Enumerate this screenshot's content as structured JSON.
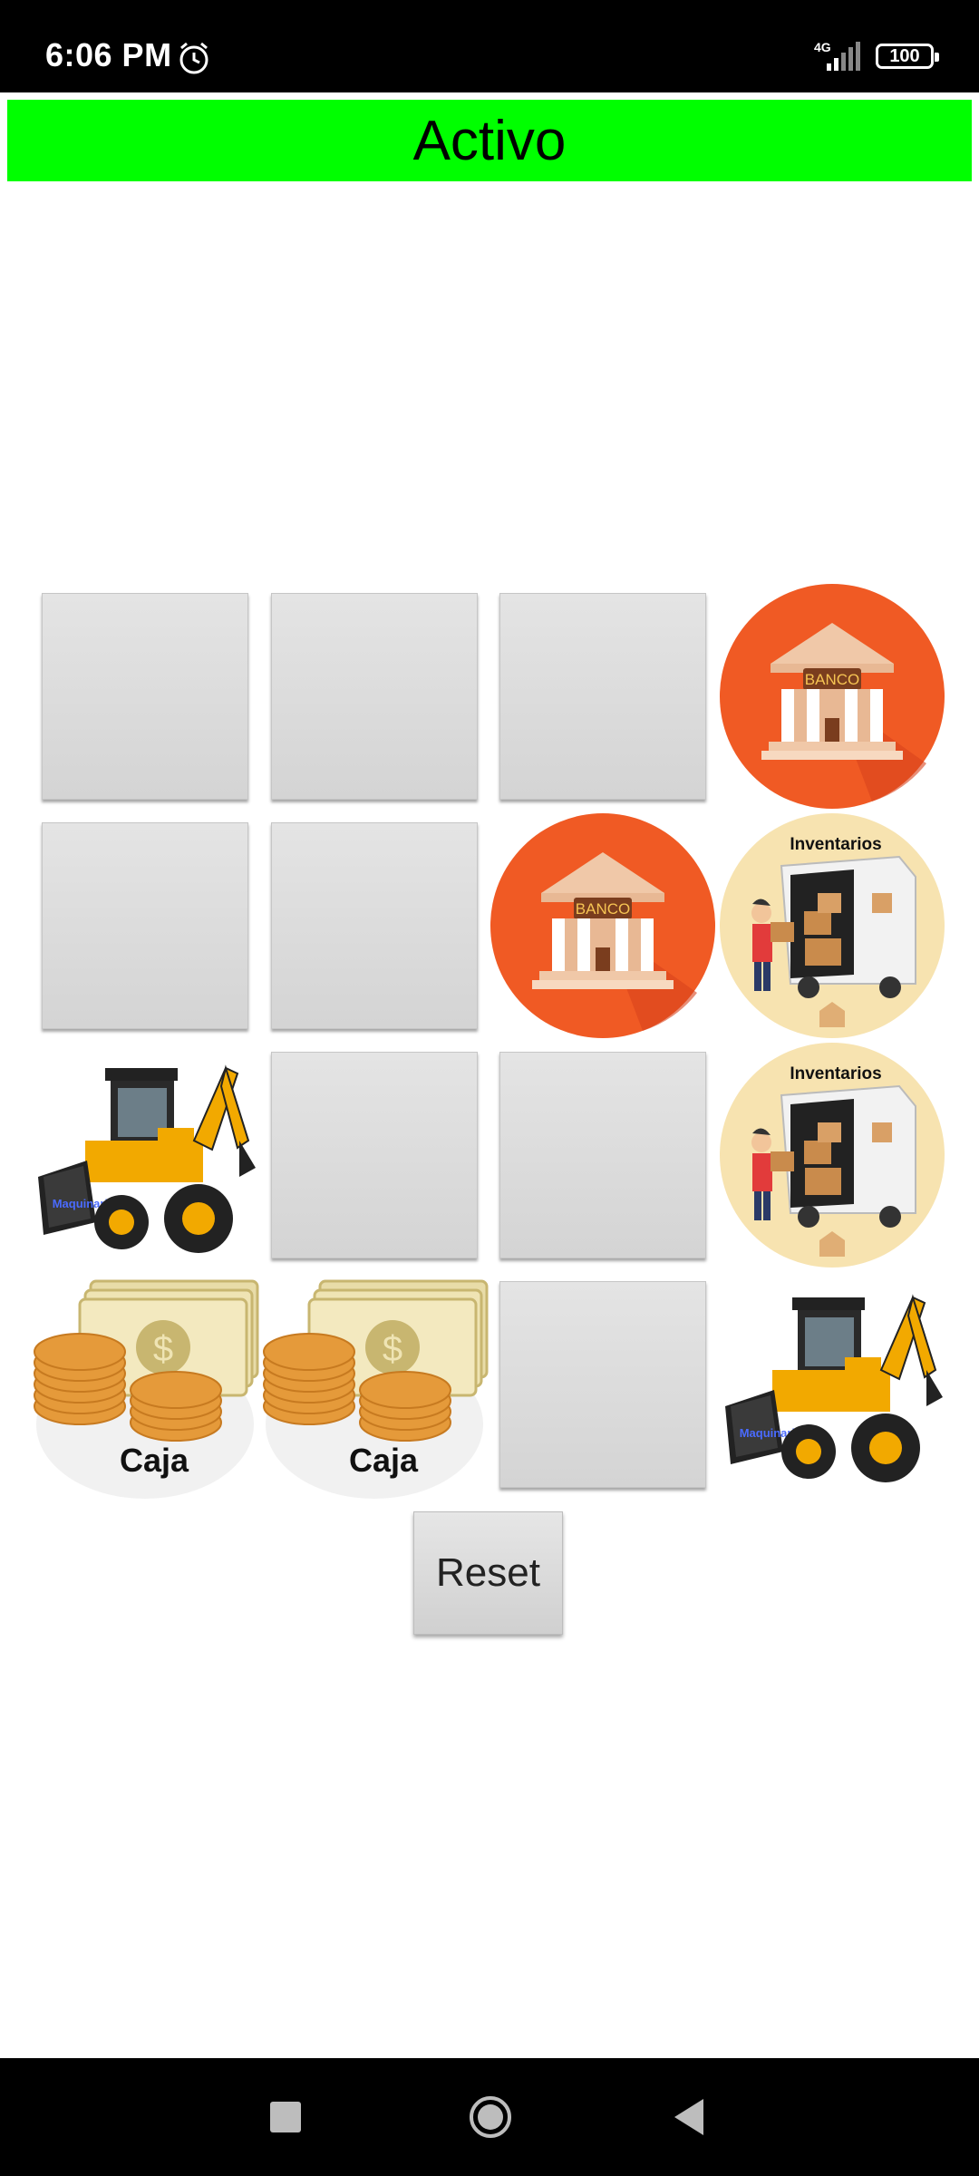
{
  "status_bar": {
    "time": "6:06 PM",
    "network": "4G",
    "battery": "100",
    "icons": [
      "alarm-icon",
      "signal-icon",
      "battery-icon"
    ]
  },
  "title": "Activo",
  "board": {
    "rows": 4,
    "cols": 4,
    "cells": [
      {
        "state": "hidden"
      },
      {
        "state": "hidden"
      },
      {
        "state": "hidden"
      },
      {
        "state": "revealed",
        "card": "banco"
      },
      {
        "state": "hidden"
      },
      {
        "state": "hidden"
      },
      {
        "state": "revealed",
        "card": "banco"
      },
      {
        "state": "revealed",
        "card": "inventarios"
      },
      {
        "state": "revealed",
        "card": "maquinaria"
      },
      {
        "state": "hidden"
      },
      {
        "state": "hidden"
      },
      {
        "state": "revealed",
        "card": "inventarios"
      },
      {
        "state": "revealed",
        "card": "caja"
      },
      {
        "state": "revealed",
        "card": "caja"
      },
      {
        "state": "hidden"
      },
      {
        "state": "revealed",
        "card": "maquinaria"
      }
    ],
    "card_labels": {
      "banco": "BANCO",
      "inventarios": "Inventarios",
      "maquinaria": "Maquinaria",
      "caja": "Caja"
    }
  },
  "reset_label": "Reset",
  "nav": {
    "icons": [
      "recents-icon",
      "home-icon",
      "back-icon"
    ]
  },
  "colors": {
    "title_bg": "#00ff00",
    "banco_bg": "#f05a24",
    "inventarios_bg": "#f7e3b0",
    "hidden_card": "#dcdcdc"
  }
}
